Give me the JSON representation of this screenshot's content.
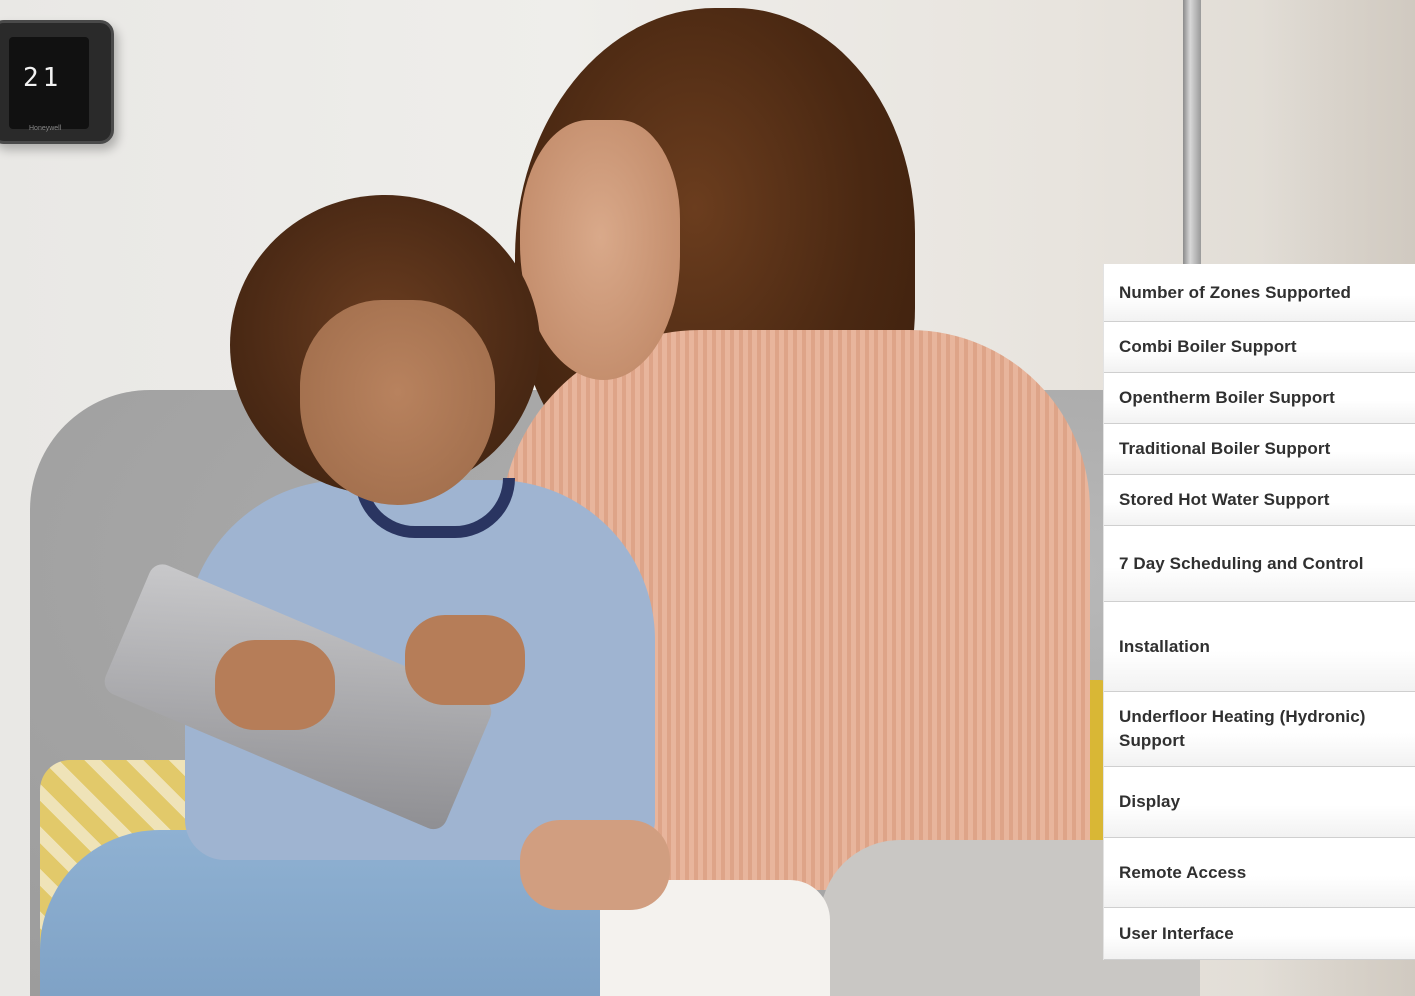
{
  "hero_image": {
    "description_icon": "family-with-tablet-photo",
    "thermostat": {
      "temperature_display": "21",
      "brand": "Honeywell"
    }
  },
  "feature_panel": {
    "rows": [
      {
        "label": "Number of Zones Supported"
      },
      {
        "label": "Combi Boiler Support"
      },
      {
        "label": "Opentherm Boiler Support"
      },
      {
        "label": "Traditional Boiler Support"
      },
      {
        "label": "Stored Hot Water Support"
      },
      {
        "label": "7 Day Scheduling and Control"
      },
      {
        "label": "Installation"
      },
      {
        "label": "Underfloor Heating (Hydronic) Support"
      },
      {
        "label": "Display"
      },
      {
        "label": "Remote Access"
      },
      {
        "label": "User Interface"
      }
    ]
  }
}
